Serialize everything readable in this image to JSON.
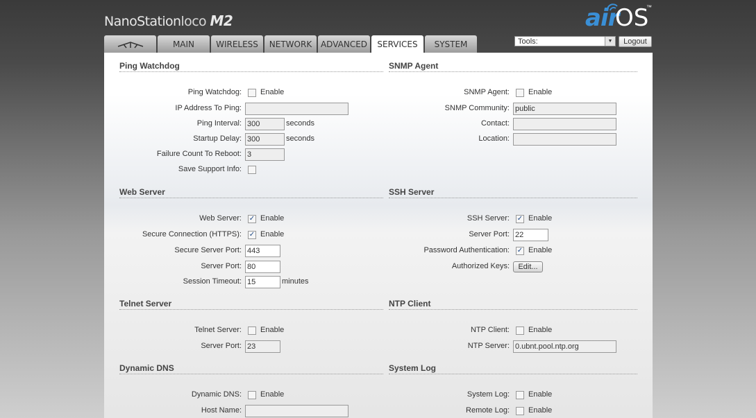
{
  "header": {
    "product_name": "NanoStation",
    "product_variant": "loco",
    "product_model": "M2",
    "logo_air": "air",
    "logo_os": "OS",
    "logo_tm": "™",
    "tools_label": "Tools:",
    "logout_label": "Logout"
  },
  "tabs": [
    {
      "label": "",
      "icon": "ubiquiti-logo-icon"
    },
    {
      "label": "MAIN"
    },
    {
      "label": "WIRELESS"
    },
    {
      "label": "NETWORK"
    },
    {
      "label": "ADVANCED"
    },
    {
      "label": "SERVICES",
      "active": true
    },
    {
      "label": "SYSTEM"
    }
  ],
  "ping_watchdog": {
    "title": "Ping Watchdog",
    "enable_label": "Ping Watchdog:",
    "enable_text": "Enable",
    "enabled": false,
    "ip_label": "IP Address To Ping:",
    "ip_value": "",
    "interval_label": "Ping Interval:",
    "interval_value": "300",
    "interval_unit": "seconds",
    "delay_label": "Startup Delay:",
    "delay_value": "300",
    "delay_unit": "seconds",
    "failure_label": "Failure Count To Reboot:",
    "failure_value": "3",
    "support_label": "Save Support Info:",
    "support_checked": false
  },
  "snmp": {
    "title": "SNMP Agent",
    "enable_label": "SNMP Agent:",
    "enable_text": "Enable",
    "enabled": false,
    "community_label": "SNMP Community:",
    "community_value": "public",
    "contact_label": "Contact:",
    "contact_value": "",
    "location_label": "Location:",
    "location_value": ""
  },
  "web_server": {
    "title": "Web Server",
    "enable_label": "Web Server:",
    "enable_text": "Enable",
    "enabled": true,
    "https_label": "Secure Connection (HTTPS):",
    "https_text": "Enable",
    "https_enabled": true,
    "secure_port_label": "Secure Server Port:",
    "secure_port_value": "443",
    "port_label": "Server Port:",
    "port_value": "80",
    "timeout_label": "Session Timeout:",
    "timeout_value": "15",
    "timeout_unit": "minutes"
  },
  "ssh": {
    "title": "SSH Server",
    "enable_label": "SSH Server:",
    "enable_text": "Enable",
    "enabled": true,
    "port_label": "Server Port:",
    "port_value": "22",
    "password_label": "Password Authentication:",
    "password_text": "Enable",
    "password_enabled": true,
    "keys_label": "Authorized Keys:",
    "keys_button": "Edit..."
  },
  "telnet": {
    "title": "Telnet Server",
    "enable_label": "Telnet Server:",
    "enable_text": "Enable",
    "enabled": false,
    "port_label": "Server Port:",
    "port_value": "23"
  },
  "ntp": {
    "title": "NTP Client",
    "enable_label": "NTP Client:",
    "enable_text": "Enable",
    "enabled": false,
    "server_label": "NTP Server:",
    "server_value": "0.ubnt.pool.ntp.org"
  },
  "ddns": {
    "title": "Dynamic DNS",
    "enable_label": "Dynamic DNS:",
    "enable_text": "Enable",
    "enabled": false,
    "host_label": "Host Name:",
    "host_value": ""
  },
  "syslog": {
    "title": "System Log",
    "enable_label": "System Log:",
    "enable_text": "Enable",
    "enabled": false,
    "remote_label": "Remote Log:",
    "remote_text": "Enable",
    "remote_enabled": false
  },
  "colors": {
    "accent": "#3a8fd6",
    "check": "#204a87"
  }
}
